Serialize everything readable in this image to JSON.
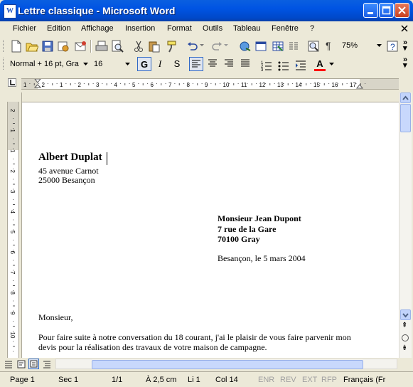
{
  "window": {
    "title": "Lettre classique - Microsoft Word",
    "app_icon": "W"
  },
  "menu": [
    {
      "label": "Fichier",
      "name": "menu-fichier"
    },
    {
      "label": "Edition",
      "name": "menu-edition"
    },
    {
      "label": "Affichage",
      "name": "menu-affichage"
    },
    {
      "label": "Insertion",
      "name": "menu-insertion"
    },
    {
      "label": "Format",
      "name": "menu-format"
    },
    {
      "label": "Outils",
      "name": "menu-outils"
    },
    {
      "label": "Tableau",
      "name": "menu-tableau"
    },
    {
      "label": "Fenêtre",
      "name": "menu-fenetre"
    },
    {
      "label": "?",
      "name": "menu-help"
    }
  ],
  "toolbar": {
    "zoom": "75%",
    "style": "Normal + 16 pt, Gra",
    "font_size": "16",
    "bold": "G",
    "italic": "I",
    "underline": "S",
    "font_color": "#ff0000",
    "highlight_label": "A"
  },
  "ruler": {
    "h_marks": [
      "1",
      "2",
      "1",
      "2",
      "3",
      "4",
      "5",
      "6",
      "7",
      "8",
      "9",
      "10",
      "11",
      "12",
      "13",
      "14",
      "15",
      "16",
      "17"
    ],
    "v_marks": [
      "2",
      "1",
      "1",
      "2",
      "3",
      "4",
      "5",
      "6",
      "7",
      "8",
      "9",
      "10"
    ]
  },
  "document": {
    "sender_name": "Albert Duplat",
    "sender_address1": "45 avenue Carnot",
    "sender_address2": "25000 Besançon",
    "recipient_name": "Monsieur Jean Dupont",
    "recipient_address1": "7 rue de la Gare",
    "recipient_address2": "70100 Gray",
    "date_line": "Besançon, le 5 mars 2004",
    "salutation": "Monsieur,",
    "body_line1": "Pour faire suite à notre conversation du 18 courant, j'ai le plaisir de vous faire parvenir mon",
    "body_line2": "devis pour la réalisation des travaux de votre maison de campagne."
  },
  "status": {
    "page": "Page  1",
    "section": "Sec  1",
    "pages": "1/1",
    "position": "À  2,5 cm",
    "line": "Li  1",
    "column": "Col  14",
    "rec": "ENR",
    "rev": "REV",
    "ext": "EXT",
    "ovr": "RFP",
    "language": "Français (Fr"
  }
}
